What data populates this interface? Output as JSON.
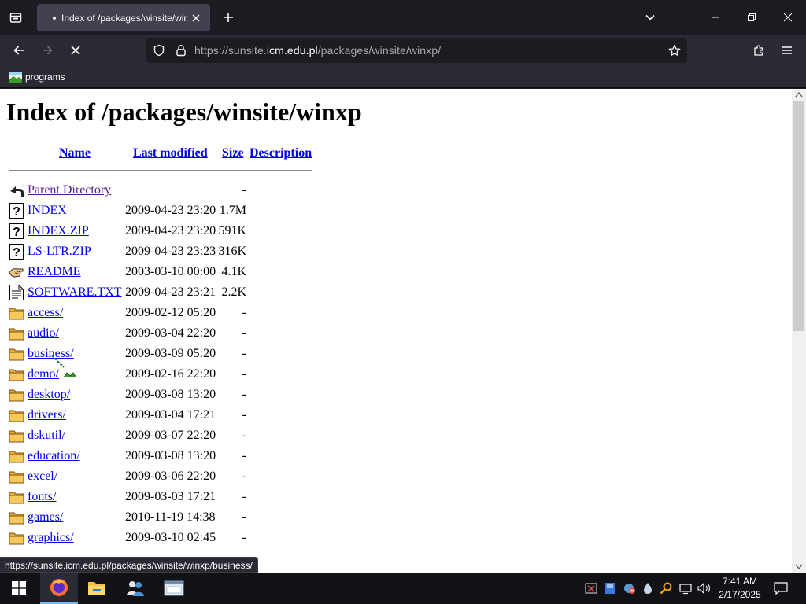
{
  "browser": {
    "tab_title": "Index of /packages/winsite/winxp/",
    "url_prefix": "https://sunsite.",
    "url_host": "icm.edu.pl",
    "url_path": "/packages/winsite/winxp/",
    "bookmarks": [
      {
        "label": "programs",
        "icon": "bookmark-image-icon"
      }
    ],
    "status_text": "https://sunsite.icm.edu.pl/packages/winsite/winxp/business/"
  },
  "page": {
    "title": "Index of /packages/winsite/winxp",
    "columns": {
      "name": "Name",
      "modified": "Last modified",
      "size": "Size",
      "description": "Description"
    },
    "rows": [
      {
        "icon": "parent-directory-icon",
        "name": "Parent Directory",
        "date": "",
        "size": "-"
      },
      {
        "icon": "unknown-file-icon",
        "name": "INDEX",
        "date": "2009-04-23 23:20",
        "size": "1.7M"
      },
      {
        "icon": "unknown-file-icon",
        "name": "INDEX.ZIP",
        "date": "2009-04-23 23:20",
        "size": "591K"
      },
      {
        "icon": "unknown-file-icon",
        "name": "LS-LTR.ZIP",
        "date": "2009-04-23 23:23",
        "size": "316K"
      },
      {
        "icon": "readme-hand-icon",
        "name": "README",
        "date": "2003-03-10 00:00",
        "size": "4.1K"
      },
      {
        "icon": "text-file-icon",
        "name": "SOFTWARE.TXT",
        "date": "2009-04-23 23:21",
        "size": "2.2K"
      },
      {
        "icon": "folder-icon",
        "name": "access/",
        "date": "2009-02-12 05:20",
        "size": "-"
      },
      {
        "icon": "folder-icon",
        "name": "audio/",
        "date": "2009-03-04 22:20",
        "size": "-"
      },
      {
        "icon": "folder-icon",
        "name": "business/",
        "date": "2009-03-09 05:20",
        "size": "-"
      },
      {
        "icon": "folder-icon",
        "name": "demo/",
        "date": "2009-02-16 22:20",
        "size": "-"
      },
      {
        "icon": "folder-icon",
        "name": "desktop/",
        "date": "2009-03-08 13:20",
        "size": "-"
      },
      {
        "icon": "folder-icon",
        "name": "drivers/",
        "date": "2009-03-04 17:21",
        "size": "-"
      },
      {
        "icon": "folder-icon",
        "name": "dskutil/",
        "date": "2009-03-07 22:20",
        "size": "-"
      },
      {
        "icon": "folder-icon",
        "name": "education/",
        "date": "2009-03-08 13:20",
        "size": "-"
      },
      {
        "icon": "folder-icon",
        "name": "excel/",
        "date": "2009-03-06 22:20",
        "size": "-"
      },
      {
        "icon": "folder-icon",
        "name": "fonts/",
        "date": "2009-03-03 17:21",
        "size": "-"
      },
      {
        "icon": "folder-icon",
        "name": "games/",
        "date": "2010-11-19 14:38",
        "size": "-"
      },
      {
        "icon": "folder-icon",
        "name": "graphics/",
        "date": "2009-03-10 02:45",
        "size": "-"
      }
    ]
  },
  "taskbar": {
    "apps": [
      {
        "name": "windows-start-icon",
        "active": false
      },
      {
        "name": "firefox-icon",
        "active": true
      },
      {
        "name": "file-explorer-icon",
        "active": false
      },
      {
        "name": "people-app-icon",
        "active": false
      },
      {
        "name": "window-app-icon",
        "active": false
      }
    ],
    "time": "7:41 AM",
    "date": "2/17/2025"
  },
  "colors": {
    "link": "#0000ee",
    "visited": "#551a8b",
    "chrome": "#2b2a33",
    "tab_active": "#42414d"
  }
}
